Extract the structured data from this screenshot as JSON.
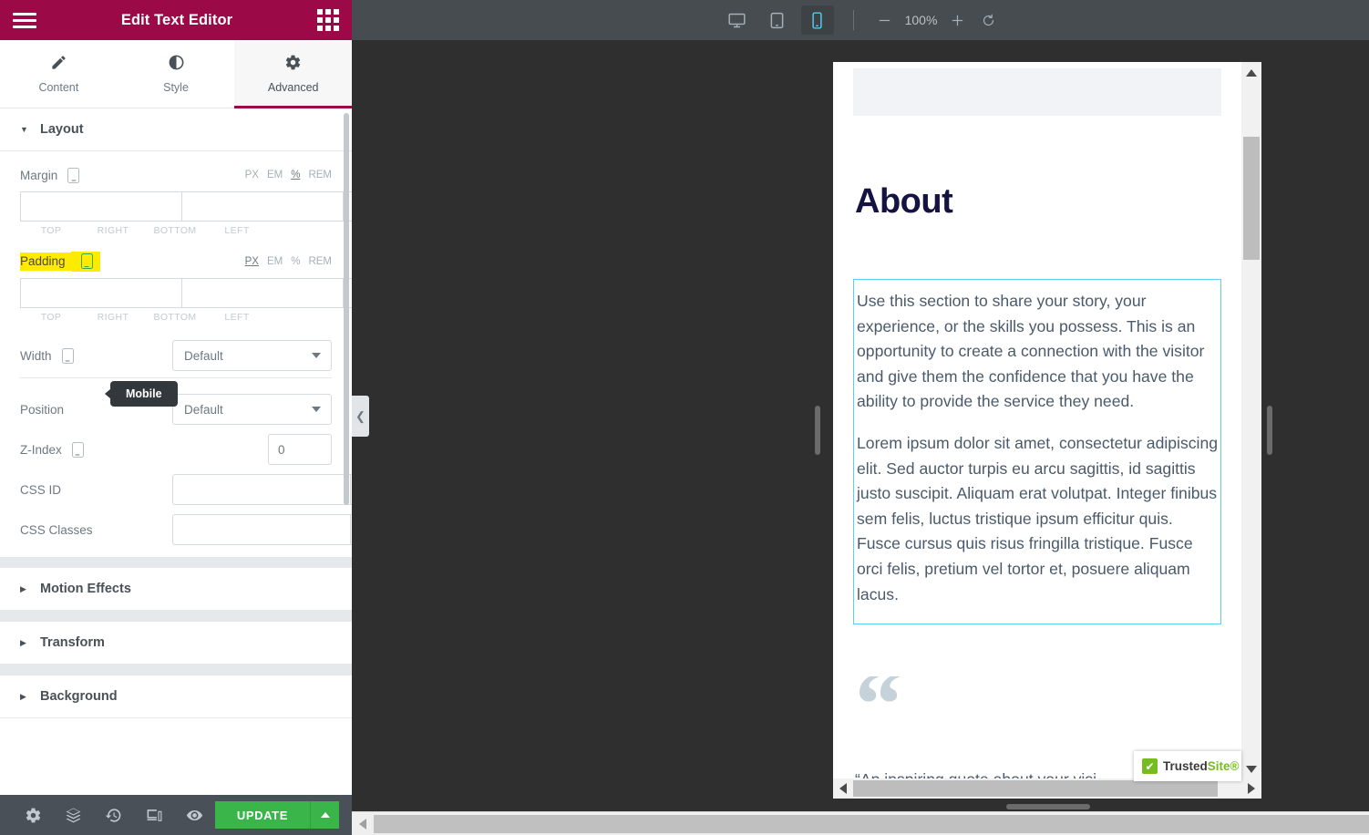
{
  "panel": {
    "header": {
      "title": "Edit Text Editor",
      "menu_icon": "hamburger-icon",
      "apps_icon": "grid-apps-icon"
    },
    "tabs": [
      {
        "label": "Content",
        "icon": "pencil-icon",
        "active": false
      },
      {
        "label": "Style",
        "icon": "contrast-icon",
        "active": false
      },
      {
        "label": "Advanced",
        "icon": "gear-icon",
        "active": true
      }
    ],
    "sections": [
      {
        "label": "Layout",
        "expanded": true
      },
      {
        "label": "Motion Effects",
        "expanded": false
      },
      {
        "label": "Transform",
        "expanded": false
      },
      {
        "label": "Background",
        "expanded": false
      }
    ],
    "layout": {
      "margin": {
        "label": "Margin",
        "units": [
          "PX",
          "EM",
          "%",
          "REM"
        ],
        "active_unit": "%",
        "values": {
          "top": "",
          "right": "",
          "bottom": "",
          "left": ""
        },
        "side_labels": [
          "TOP",
          "RIGHT",
          "BOTTOM",
          "LEFT"
        ],
        "link_icon": "link-chain-icon"
      },
      "padding": {
        "label": "Padding",
        "highlighted": true,
        "units": [
          "PX",
          "EM",
          "%",
          "REM"
        ],
        "active_unit": "PX",
        "values": {
          "top": "",
          "right": "",
          "bottom": "",
          "left": ""
        },
        "side_labels": [
          "TOP",
          "RIGHT",
          "BOTTOM",
          "LEFT"
        ],
        "link_icon": "link-chain-icon"
      },
      "width": {
        "label": "Width",
        "value": "Default"
      },
      "position": {
        "label": "Position",
        "value": "Default"
      },
      "z_index": {
        "label": "Z-Index",
        "value": "0"
      },
      "css_id": {
        "label": "CSS ID",
        "value": "",
        "tag_icon": "dynamic-tags-icon"
      },
      "css_classes": {
        "label": "CSS Classes",
        "value": "",
        "tag_icon": "dynamic-tags-icon"
      }
    },
    "tooltip": {
      "text": "Mobile"
    },
    "footer": {
      "icons": [
        {
          "name": "settings-gear-icon"
        },
        {
          "name": "navigator-layers-icon"
        },
        {
          "name": "history-clock-icon"
        },
        {
          "name": "responsive-mode-icon"
        },
        {
          "name": "preview-eye-icon"
        }
      ],
      "update_label": "UPDATE",
      "update_more_icon": "chevron-up-icon"
    },
    "collapse_handle_icon": "chevron-left-icon"
  },
  "topbar": {
    "devices": [
      {
        "name": "desktop-view",
        "icon": "desktop-icon",
        "active": false
      },
      {
        "name": "tablet-view",
        "icon": "tablet-icon",
        "active": false
      },
      {
        "name": "mobile-view",
        "icon": "mobile-icon",
        "active": true
      }
    ],
    "zoom_out_icon": "minus-icon",
    "zoom_value": "100%",
    "zoom_in_icon": "plus-icon",
    "zoom_reset_icon": "reset-rotate-icon"
  },
  "preview": {
    "heading": "About",
    "paragraphs": [
      "Use this section to share your story, your experience, or the skills you possess. This is an opportunity to create a connection with the visitor and give them the confidence that you have the ability to provide the service they need.",
      "Lorem ipsum dolor sit amet, consectetur adipiscing elit. Sed auctor turpis eu arcu sagittis, id sagittis justo suscipit. Aliquam erat volutpat. Integer finibus sem felis, luctus tristique ipsum efficitur quis. Fusce cursus quis risus fringilla tristique. Fusce orci felis, pretium vel tortor et, posuere aliquam lacus."
    ],
    "quote_mark": "“",
    "quote_text": "“An inspiring quote about your visi"
  },
  "trustedsite": {
    "part1": "Trusted",
    "part2": "Site®",
    "check": "✔"
  },
  "colors": {
    "panel_header": "#9b0a46",
    "accent_active_tab": "#9b0a46",
    "update_green": "#39b54a",
    "highlight_yellow": "#ffeb00",
    "device_active": "#53c9f5",
    "textbox_border": "#5ecdf2",
    "heading_navy": "#141341",
    "trustedsite_green": "#76bc21"
  }
}
